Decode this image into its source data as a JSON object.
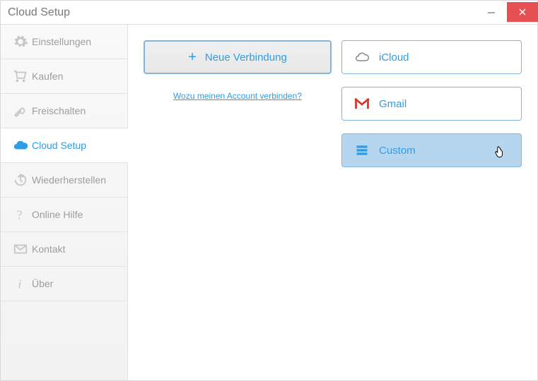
{
  "window": {
    "title": "Cloud Setup"
  },
  "sidebar": {
    "items": [
      {
        "label": "Einstellungen",
        "icon": "gear-icon",
        "active": false
      },
      {
        "label": "Kaufen",
        "icon": "cart-icon",
        "active": false
      },
      {
        "label": "Freischalten",
        "icon": "key-icon",
        "active": false
      },
      {
        "label": "Cloud Setup",
        "icon": "cloud-icon",
        "active": true
      },
      {
        "label": "Wiederherstellen",
        "icon": "restore-icon",
        "active": false
      },
      {
        "label": "Online Hilfe",
        "icon": "help-icon",
        "active": false
      },
      {
        "label": "Kontakt",
        "icon": "mail-icon",
        "active": false
      },
      {
        "label": "Über",
        "icon": "info-icon",
        "active": false
      }
    ]
  },
  "main": {
    "new_connection_label": "Neue Verbindung",
    "help_link_label": "Wozu meinen Account verbinden?",
    "providers": [
      {
        "label": "iCloud",
        "icon": "cloud-outline-icon",
        "selected": false
      },
      {
        "label": "Gmail",
        "icon": "gmail-icon",
        "selected": false
      },
      {
        "label": "Custom",
        "icon": "server-icon",
        "selected": true
      }
    ]
  },
  "colors": {
    "accent": "#2e9de3",
    "close_button": "#e65052",
    "selected_bg": "#b6d6f0",
    "border_accent": "#83b6df",
    "sidebar_text": "#9d9d9d"
  }
}
